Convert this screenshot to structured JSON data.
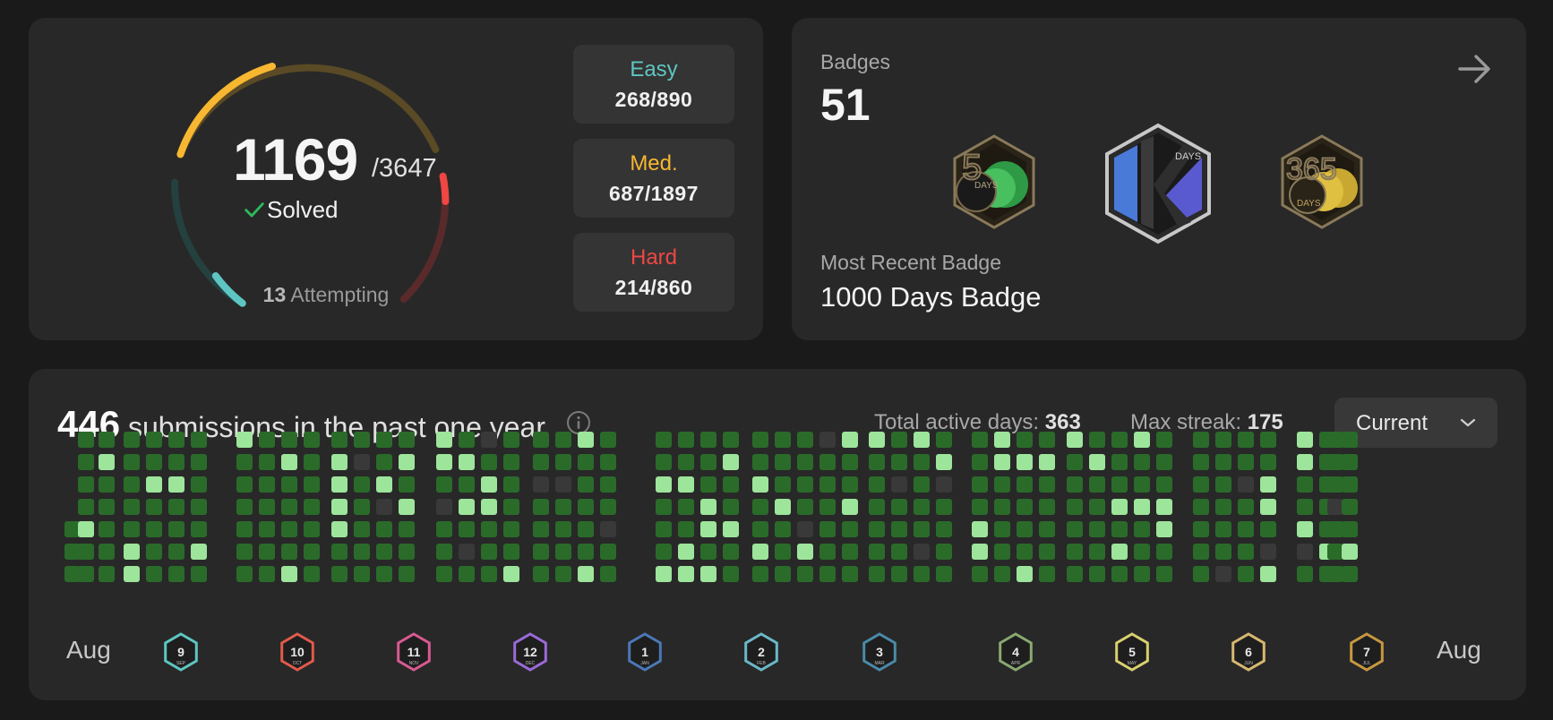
{
  "solved": {
    "count": "1169",
    "total": "/3647",
    "label": "Solved",
    "attempting_count": "13",
    "attempting_label": "Attempting",
    "difficulties": [
      {
        "label": "Easy",
        "value": "268/890",
        "color": "#5ec6c2"
      },
      {
        "label": "Med.",
        "value": "687/1897",
        "color": "#f7b731"
      },
      {
        "label": "Hard",
        "value": "214/860",
        "color": "#ef4743"
      }
    ]
  },
  "badges": {
    "label": "Badges",
    "count": "51",
    "recent_label": "Most Recent Badge",
    "recent_name": "1000 Days Badge",
    "icons": [
      "50-days-badge-icon",
      "1000-days-badge-icon",
      "365-days-badge-icon"
    ]
  },
  "heatmap": {
    "count": "446",
    "title": "submissions in the past one year",
    "active_days_label": "Total active days:",
    "active_days": "363",
    "max_streak_label": "Max streak:",
    "max_streak": "175",
    "dropdown_value": "Current",
    "month_start": "Aug",
    "month_end": "Aug",
    "monthly_badges": [
      {
        "num": "9",
        "mon": "SEP",
        "color": "#5ec6c2"
      },
      {
        "num": "10",
        "mon": "OCT",
        "color": "#e05a4a"
      },
      {
        "num": "11",
        "mon": "NOV",
        "color": "#d85a92"
      },
      {
        "num": "12",
        "mon": "DEC",
        "color": "#9a6ad8"
      },
      {
        "num": "1",
        "mon": "JAN",
        "color": "#4a78b8"
      },
      {
        "num": "2",
        "mon": "FEB",
        "color": "#6ab8c8"
      },
      {
        "num": "3",
        "mon": "MAR",
        "color": "#4a8aa8"
      },
      {
        "num": "4",
        "mon": "APR",
        "color": "#8aa870"
      },
      {
        "num": "5",
        "mon": "MAY",
        "color": "#d8d070"
      },
      {
        "num": "6",
        "mon": "JUN",
        "color": "#d8b870"
      },
      {
        "num": "7",
        "mon": "JUL",
        "color": "#c89840"
      }
    ],
    "colors": {
      "empty": "#393939",
      "low": "#2a6b2a",
      "high": "#9de59b"
    }
  }
}
